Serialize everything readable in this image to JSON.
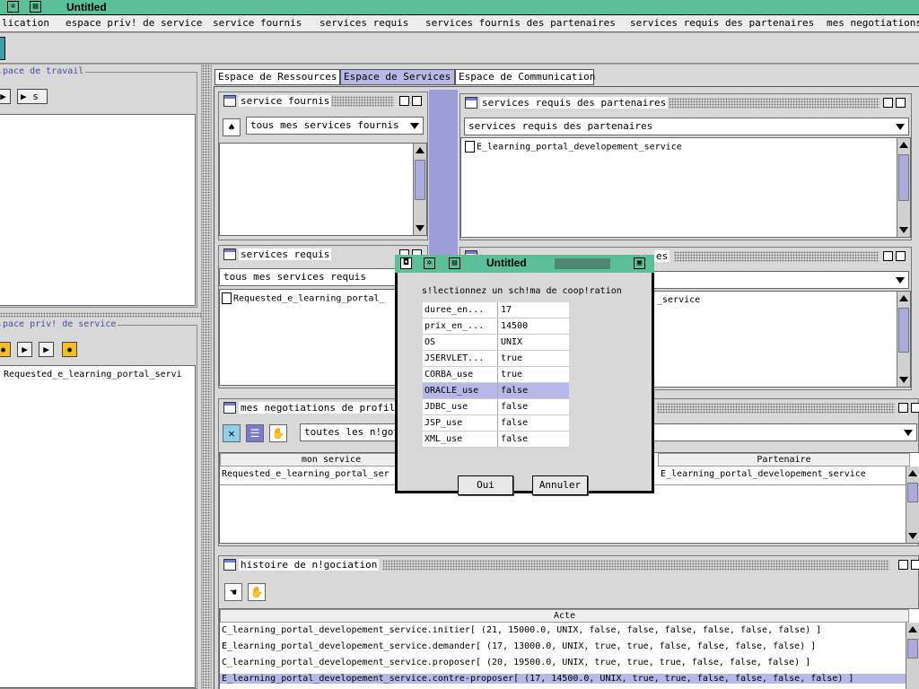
{
  "window": {
    "title": "Untitled"
  },
  "menu": [
    "lication",
    "espace priv! de service",
    "service fournis",
    "services requis",
    "services fournis des partenaires",
    "services requis des partenaires",
    "mes negotiations"
  ],
  "left": {
    "workspace_title": "pace de travail",
    "workspace_btn_label": "s",
    "private_title": "pace priv! de service",
    "private_item": "Requested_e_learning_portal_servi"
  },
  "tabs": [
    "Espace de Ressources",
    "Espace de Services",
    "Espace de Communication"
  ],
  "active_tab": "Espace de Services",
  "fournis": {
    "title": "service fournis",
    "combo": "tous mes services fournis"
  },
  "requis_part": {
    "title": "services requis des partenaires",
    "combo": "services requis des partenaires",
    "item": "E_learning_portal_developement_service"
  },
  "requis": {
    "title": "services requis",
    "combo": "tous mes services requis",
    "item": "Requested_e_learning_portal_"
  },
  "fournis_part": {
    "title_suffix": "es",
    "item": "_service"
  },
  "negotiations": {
    "title": "mes negotiations de profile",
    "combo": "toutes les n!got",
    "col_mine": "mon service",
    "col_partner": "Partenaire",
    "row_mine": "Requested_e_learning_portal_ser",
    "row_partner": "E_learning_portal_developement_service"
  },
  "history": {
    "title": "histoire de n!gociation",
    "col": "Acte",
    "rows": [
      "C_learning_portal_developement_service.initier[ (21, 15000.0, UNIX, false, false, false, false, false, false) ]",
      "E_learning_portal_developement_service.demander[ (17, 13000.0, UNIX, true, true, false, false, false, false) ]",
      "C_learning_portal_developement_service.proposer[ (20, 19500.0, UNIX, true, true, true, false, false, false) ]",
      "E_learning_portal_developement_service.contre-proposer[ (17, 14500.0, UNIX, true, true, false, false, false, false) ]"
    ]
  },
  "dialog": {
    "title": "Untitled",
    "prompt": "s!lectionnez un sch!ma de coop!ration",
    "rows": [
      {
        "k": "duree_en...",
        "v": "17"
      },
      {
        "k": "prix_en_...",
        "v": "14500"
      },
      {
        "k": "OS",
        "v": "UNIX"
      },
      {
        "k": "JSERVLET...",
        "v": "true"
      },
      {
        "k": "CORBA_use",
        "v": "true"
      },
      {
        "k": "ORACLE_use",
        "v": "false"
      },
      {
        "k": "JDBC_use",
        "v": "false"
      },
      {
        "k": "JSP_use",
        "v": "false"
      },
      {
        "k": "XML_use",
        "v": "false"
      }
    ],
    "selected_row": "ORACLE_use",
    "ok": "Oui",
    "cancel": "Annuler"
  },
  "colors": {
    "titlebar": "#5bbf99",
    "selection": "#b8b8e6",
    "desktop": "#a8a8a8"
  }
}
